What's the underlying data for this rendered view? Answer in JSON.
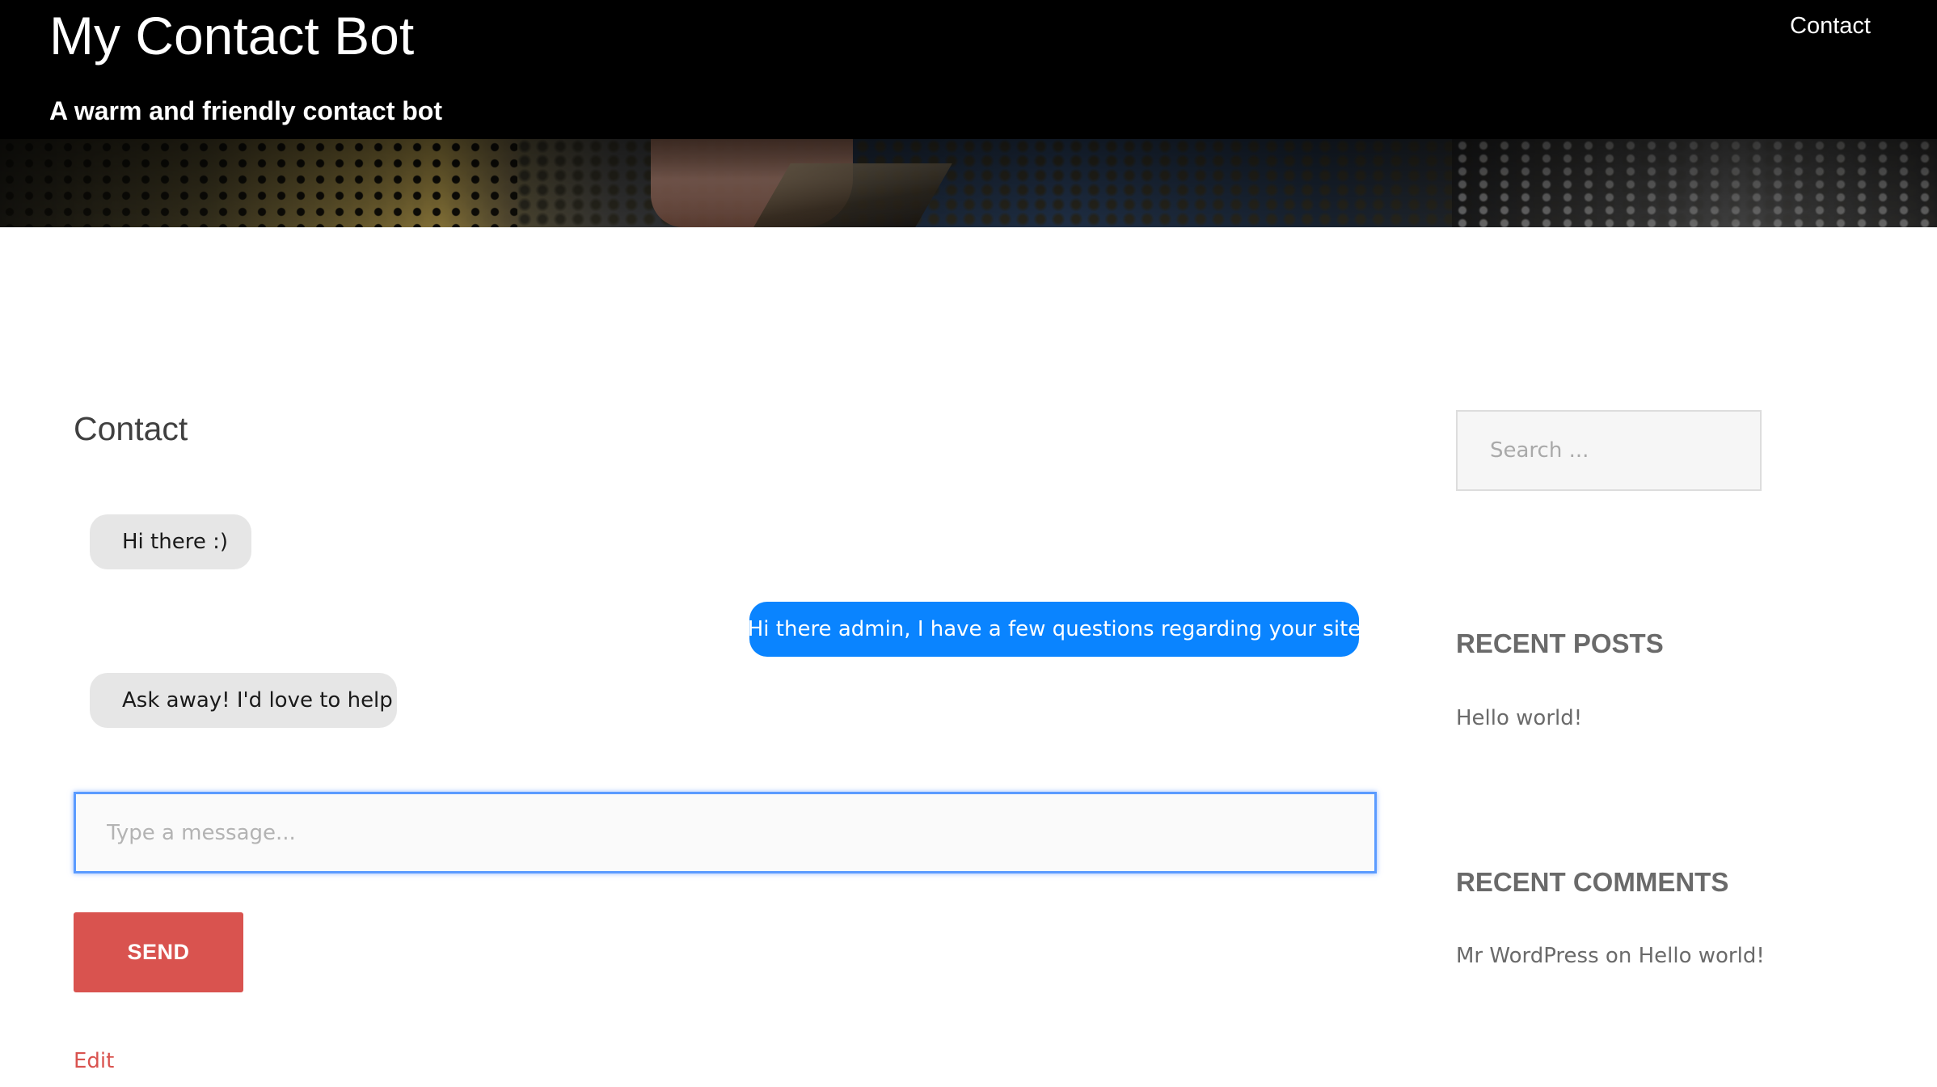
{
  "header": {
    "site_title": "My Contact Bot",
    "site_description": "A warm and friendly contact bot",
    "nav": {
      "contact_label": "Contact"
    }
  },
  "main": {
    "page_title": "Contact",
    "messages": [
      {
        "sender": "bot",
        "text": "Hi there :)"
      },
      {
        "sender": "user",
        "text": "Hi there admin, I have a few questions regarding your site"
      },
      {
        "sender": "bot",
        "text": "Ask away! I'd love to help"
      }
    ],
    "message_input": {
      "placeholder": "Type a message...",
      "value": ""
    },
    "send_label": "SEND",
    "edit_label": "Edit"
  },
  "sidebar": {
    "search": {
      "placeholder": "Search ...",
      "value": ""
    },
    "recent_posts": {
      "title": "RECENT POSTS",
      "items": [
        "Hello world!"
      ]
    },
    "recent_comments": {
      "title": "RECENT COMMENTS",
      "items": [
        {
          "author": "Mr WordPress",
          "connector": " on ",
          "post": "Hello world!"
        }
      ]
    }
  },
  "colors": {
    "bot_bubble": "#e6e6e6",
    "user_bubble": "#0a84ff",
    "send_button": "#d9534f",
    "edit_link": "#d9534f",
    "input_focus_border": "#5b9bff"
  }
}
